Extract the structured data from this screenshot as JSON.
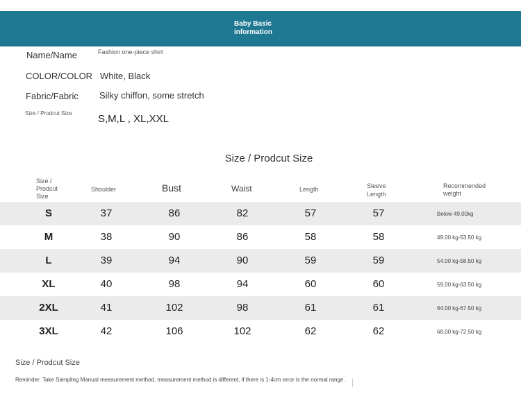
{
  "banner": {
    "title": "Baby Basic information",
    "color": "#1e7891"
  },
  "info": {
    "name_label": "Name/Name",
    "name_value": "Fashion one-piece shirt",
    "color_label": "COLOR/COLOR",
    "color_value": "White, Black",
    "fabric_label": "Fabric/Fabric",
    "fabric_value": "Silky chiffon, some stretch",
    "size_label": "Size / Prodcut Size",
    "size_value": "S,M,L , XL,XXL"
  },
  "size_table": {
    "title": "Size / Prodcut Size",
    "headers": [
      "Size / Prodcut Size",
      "Shoulder",
      "Bust",
      "Waist",
      "Length",
      "Sleeve Length",
      "Recommended weight"
    ],
    "rows": [
      {
        "size": "S",
        "shoulder": "37",
        "bust": "86",
        "waist": "82",
        "length": "57",
        "sleeve": "57",
        "weight": "Below 49.00kg"
      },
      {
        "size": "M",
        "shoulder": "38",
        "bust": "90",
        "waist": "86",
        "length": "58",
        "sleeve": "58",
        "weight": "49.00 kg-53.50 kg"
      },
      {
        "size": "L",
        "shoulder": "39",
        "bust": "94",
        "waist": "90",
        "length": "59",
        "sleeve": "59",
        "weight": "54.00 kg-58.50 kg"
      },
      {
        "size": "XL",
        "shoulder": "40",
        "bust": "98",
        "waist": "94",
        "length": "60",
        "sleeve": "60",
        "weight": "59.00 kg-63.50 kg"
      },
      {
        "size": "2XL",
        "shoulder": "41",
        "bust": "102",
        "waist": "98",
        "length": "61",
        "sleeve": "61",
        "weight": "64.00 kg-67.50 kg"
      },
      {
        "size": "3XL",
        "shoulder": "42",
        "bust": "106",
        "waist": "102",
        "length": "62",
        "sleeve": "62",
        "weight": "68.00 kg-72.50 kg"
      }
    ]
  },
  "footer": {
    "title": "Size / Prodcut Size",
    "reminder": "Reminder: Take Sampling Manual measurement method, measurement method is different, if there is 1-4cm error is the normal range."
  }
}
